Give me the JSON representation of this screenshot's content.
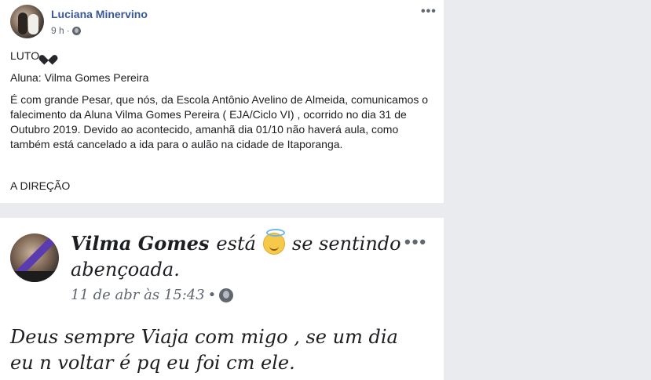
{
  "post1": {
    "author": "Luciana Minervino",
    "time": "9 h",
    "separator": "·",
    "privacy_icon": "globe-icon",
    "more_icon": "•••",
    "luto": "LUTO",
    "aluna": "Aluna: Vilma Gomes Pereira",
    "body": "É com grande Pesar, que nós, da Escola Antônio Avelino de Almeida, comunicamos o falecimento da Aluna Vilma Gomes Pereira ( EJA/Ciclo VI) , ocorrido no dia 31 de Outubro 2019. Devido ao acontecido, amanhã dia 01/10 não haverá aula, como também está cancelado a ida para o aulão na cidade de Itaporanga.",
    "signature": "A DIREÇÃO"
  },
  "post2": {
    "author": "Vilma Gomes",
    "status_prefix": "está",
    "status_suffix": "se sentindo",
    "status_line2": "abençoada.",
    "time": "11 de abr às 15:43",
    "separator": "•",
    "more_icon": "•••",
    "body": "Deus sempre Viaja com migo , se um dia eu n voltar é pq eu foi cm ele."
  }
}
